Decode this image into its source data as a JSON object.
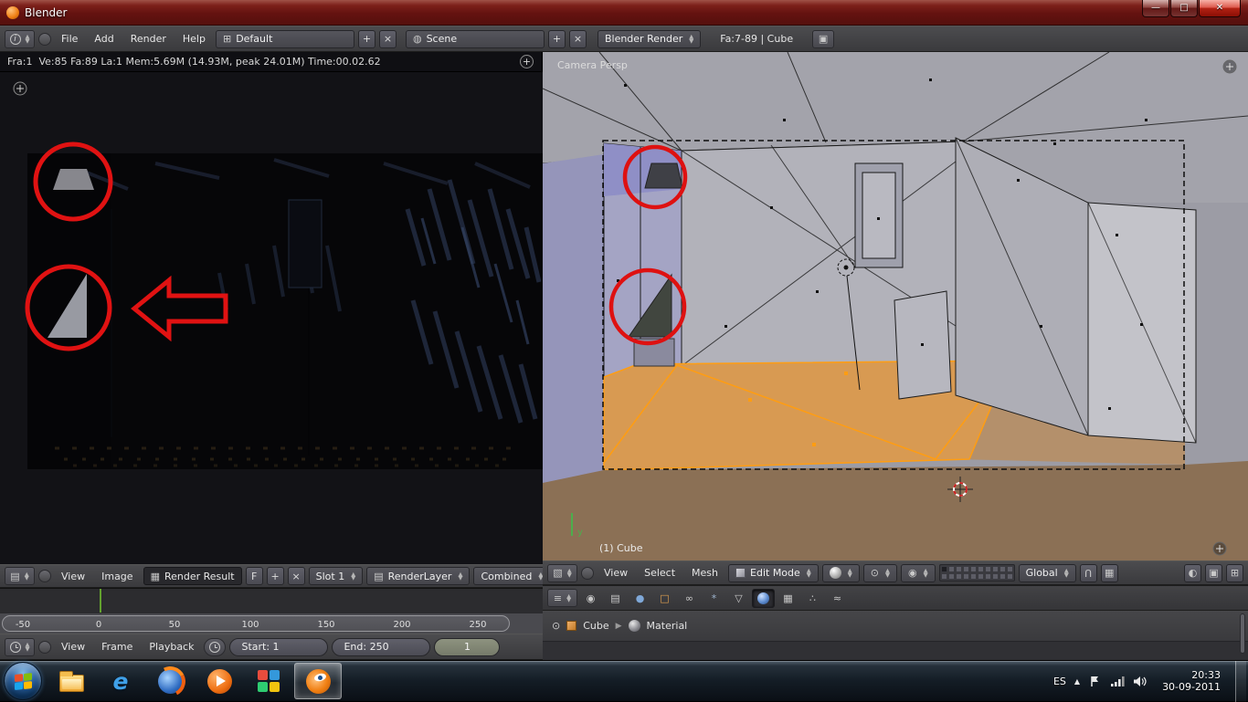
{
  "window": {
    "title": "Blender"
  },
  "topbar": {
    "menus": [
      "File",
      "Add",
      "Render",
      "Help"
    ],
    "layout": "Default",
    "scene": "Scene",
    "engine": "Blender Render",
    "stats": "Fa:7-89 | Cube"
  },
  "image_editor": {
    "render_stats": "Fra:1  Ve:85 Fa:89 La:1 Mem:5.69M (14.93M, peak 24.01M) Time:00.02.62",
    "menus": {
      "view": "View",
      "image": "Image"
    },
    "datablock": "Render Result",
    "fake_user": "F",
    "slot": "Slot 1",
    "render_layer": "RenderLayer",
    "render_pass": "Combined"
  },
  "timeline": {
    "ticks": [
      "-50",
      "0",
      "50",
      "100",
      "150",
      "200",
      "250"
    ],
    "menus": {
      "view": "View",
      "frame": "Frame",
      "playback": "Playback"
    },
    "start": "Start: 1",
    "end": "End: 250",
    "current_frame": "1"
  },
  "viewport": {
    "view_label": "Camera Persp",
    "object_label": "(1) Cube",
    "axis_label": "y",
    "menus": {
      "view": "View",
      "select": "Select",
      "mesh": "Mesh"
    },
    "mode": "Edit Mode",
    "orientation": "Global"
  },
  "properties": {
    "breadcrumb": {
      "object": "Cube",
      "context": "Material"
    }
  },
  "taskbar": {
    "language": "ES",
    "clock": {
      "time": "20:33",
      "date": "30-09-2011"
    }
  }
}
